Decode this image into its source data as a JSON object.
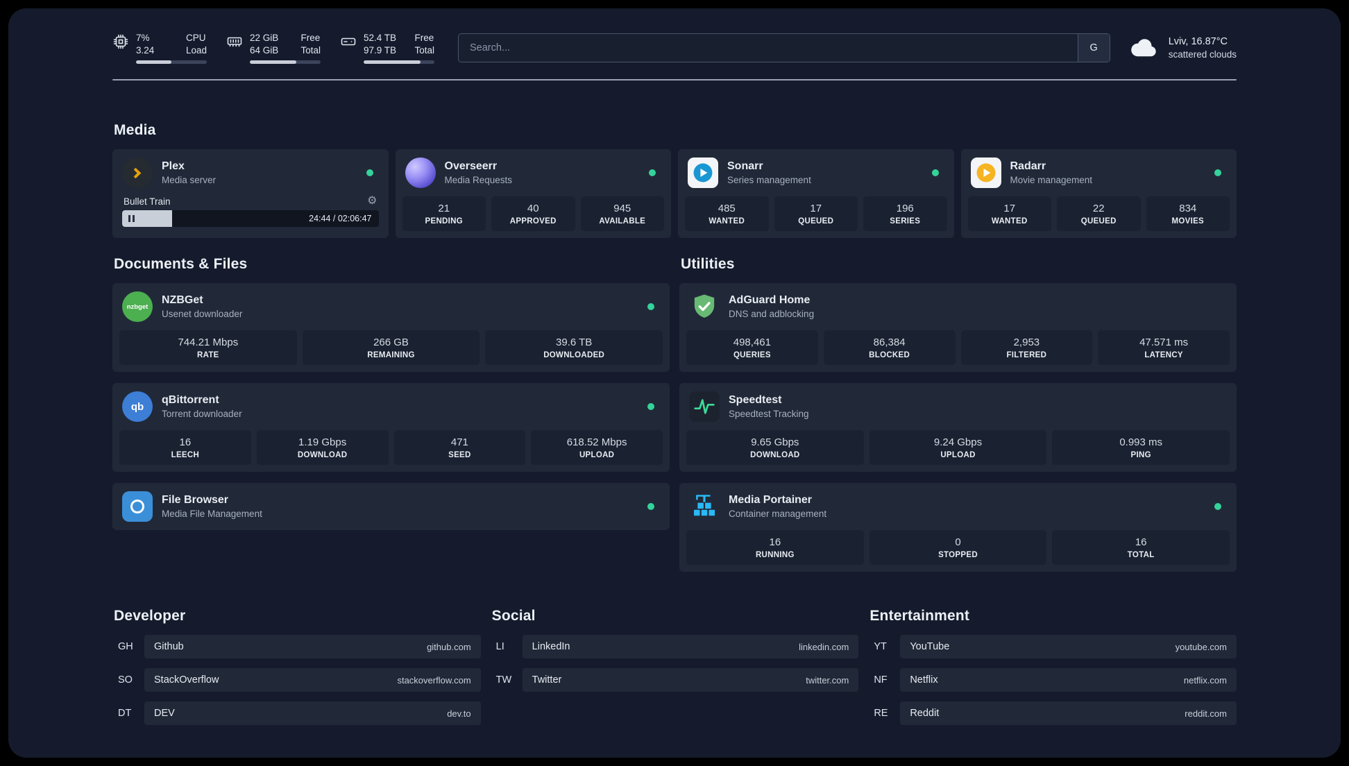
{
  "colors": {
    "page_bg": "#151b2c",
    "card_bg": "#212938",
    "stat_bg": "#1a2130",
    "status_online": "#34d399",
    "plex_accent": "#e5a00d",
    "sonarr_blue": "#1997d3",
    "radarr_amber": "#f6b322",
    "adguard_green": "#68b974",
    "portainer_blue": "#29b9f6"
  },
  "icons": {
    "gear_glyph": "⚙",
    "nzbget_label": "nzbget",
    "qbittorrent_label": "qb"
  },
  "topbar": {
    "cpu": {
      "value_top": "7%",
      "value_bottom": "3.24",
      "label_top": "CPU",
      "label_bottom": "Load",
      "progress_pct": 50
    },
    "memory": {
      "value_top": "22 GiB",
      "value_bottom": "64 GiB",
      "label_top": "Free",
      "label_bottom": "Total",
      "progress_pct": 66
    },
    "disk": {
      "value_top": "52.4 TB",
      "value_bottom": "97.9 TB",
      "label_top": "Free",
      "label_bottom": "Total",
      "progress_pct": 80
    },
    "search": {
      "placeholder": "Search...",
      "provider": "G"
    },
    "weather": {
      "location": "Lviv, 16.87°C",
      "condition": "scattered clouds"
    }
  },
  "media": {
    "title": "Media",
    "cards": [
      {
        "name": "Plex",
        "subtitle": "Media server",
        "status": "online",
        "player": {
          "track": "Bullet Train",
          "time": "24:44 / 02:06:47",
          "progress_pct": 19.5
        }
      },
      {
        "name": "Overseerr",
        "subtitle": "Media Requests",
        "status": "online",
        "stats": [
          {
            "value": "21",
            "label": "PENDING"
          },
          {
            "value": "40",
            "label": "APPROVED"
          },
          {
            "value": "945",
            "label": "AVAILABLE"
          }
        ]
      },
      {
        "name": "Sonarr",
        "subtitle": "Series management",
        "status": "online",
        "stats": [
          {
            "value": "485",
            "label": "WANTED"
          },
          {
            "value": "17",
            "label": "QUEUED"
          },
          {
            "value": "196",
            "label": "SERIES"
          }
        ]
      },
      {
        "name": "Radarr",
        "subtitle": "Movie management",
        "status": "online",
        "stats": [
          {
            "value": "17",
            "label": "WANTED"
          },
          {
            "value": "22",
            "label": "QUEUED"
          },
          {
            "value": "834",
            "label": "MOVIES"
          }
        ]
      }
    ]
  },
  "documents": {
    "title": "Documents & Files",
    "cards": [
      {
        "name": "NZBGet",
        "subtitle": "Usenet downloader",
        "status": "online",
        "stats": [
          {
            "value": "744.21 Mbps",
            "label": "RATE"
          },
          {
            "value": "266 GB",
            "label": "REMAINING"
          },
          {
            "value": "39.6 TB",
            "label": "DOWNLOADED"
          }
        ]
      },
      {
        "name": "qBittorrent",
        "subtitle": "Torrent downloader",
        "status": "online",
        "stats": [
          {
            "value": "16",
            "label": "LEECH"
          },
          {
            "value": "1.19 Gbps",
            "label": "DOWNLOAD"
          },
          {
            "value": "471",
            "label": "SEED"
          },
          {
            "value": "618.52 Mbps",
            "label": "UPLOAD"
          }
        ]
      },
      {
        "name": "File Browser",
        "subtitle": "Media File Management",
        "status": "online",
        "stats": []
      }
    ]
  },
  "utilities": {
    "title": "Utilities",
    "cards": [
      {
        "name": "AdGuard Home",
        "subtitle": "DNS and adblocking",
        "stats": [
          {
            "value": "498,461",
            "label": "QUERIES"
          },
          {
            "value": "86,384",
            "label": "BLOCKED"
          },
          {
            "value": "2,953",
            "label": "FILTERED"
          },
          {
            "value": "47.571 ms",
            "label": "LATENCY"
          }
        ]
      },
      {
        "name": "Speedtest",
        "subtitle": "Speedtest Tracking",
        "stats": [
          {
            "value": "9.65 Gbps",
            "label": "DOWNLOAD"
          },
          {
            "value": "9.24 Gbps",
            "label": "UPLOAD"
          },
          {
            "value": "0.993 ms",
            "label": "PING"
          }
        ]
      },
      {
        "name": "Media Portainer",
        "subtitle": "Container management",
        "status": "online",
        "stats": [
          {
            "value": "16",
            "label": "RUNNING"
          },
          {
            "value": "0",
            "label": "STOPPED"
          },
          {
            "value": "16",
            "label": "TOTAL"
          }
        ]
      }
    ]
  },
  "bookmarks": [
    {
      "title": "Developer",
      "items": [
        {
          "abbr": "GH",
          "name": "Github",
          "domain": "github.com"
        },
        {
          "abbr": "SO",
          "name": "StackOverflow",
          "domain": "stackoverflow.com"
        },
        {
          "abbr": "DT",
          "name": "DEV",
          "domain": "dev.to"
        }
      ]
    },
    {
      "title": "Social",
      "items": [
        {
          "abbr": "LI",
          "name": "LinkedIn",
          "domain": "linkedin.com"
        },
        {
          "abbr": "TW",
          "name": "Twitter",
          "domain": "twitter.com"
        }
      ]
    },
    {
      "title": "Entertainment",
      "items": [
        {
          "abbr": "YT",
          "name": "YouTube",
          "domain": "youtube.com"
        },
        {
          "abbr": "NF",
          "name": "Netflix",
          "domain": "netflix.com"
        },
        {
          "abbr": "RE",
          "name": "Reddit",
          "domain": "reddit.com"
        }
      ]
    }
  ]
}
